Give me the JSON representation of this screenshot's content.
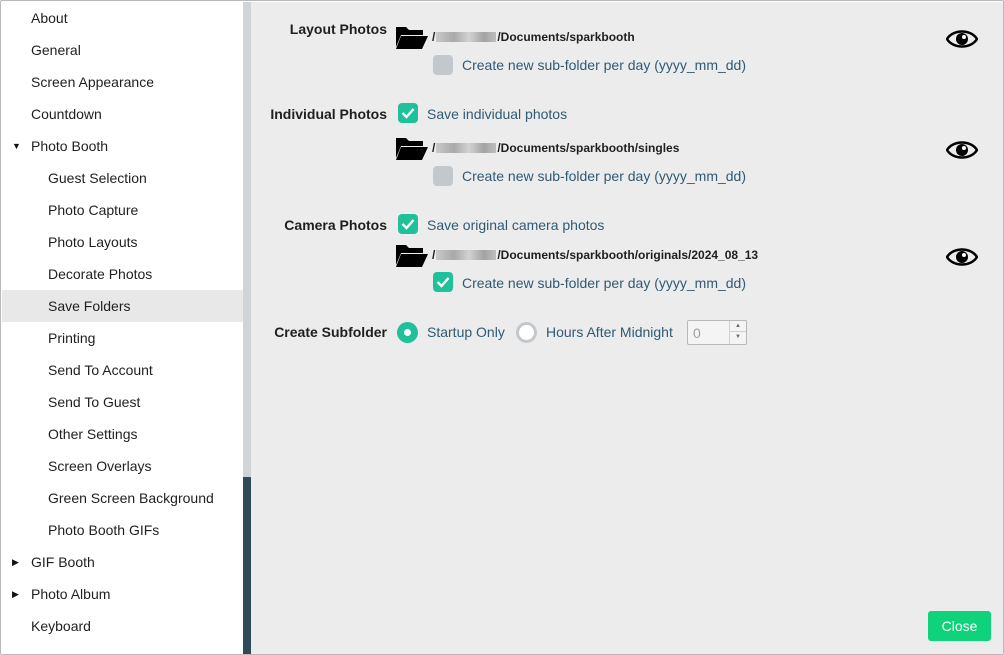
{
  "sidebar": {
    "items": [
      {
        "label": "About"
      },
      {
        "label": "General"
      },
      {
        "label": "Screen Appearance"
      },
      {
        "label": "Countdown"
      },
      {
        "label": "Photo Booth",
        "expanded": true
      },
      {
        "label": "Guest Selection"
      },
      {
        "label": "Photo Capture"
      },
      {
        "label": "Photo Layouts"
      },
      {
        "label": "Decorate Photos"
      },
      {
        "label": "Save Folders",
        "active": true
      },
      {
        "label": "Printing"
      },
      {
        "label": "Send To Account"
      },
      {
        "label": "Send To Guest"
      },
      {
        "label": "Other Settings"
      },
      {
        "label": "Screen Overlays"
      },
      {
        "label": "Green Screen Background"
      },
      {
        "label": "Photo Booth GIFs"
      },
      {
        "label": "GIF Booth",
        "expanded": false
      },
      {
        "label": "Photo Album",
        "expanded": false
      },
      {
        "label": "Keyboard"
      }
    ]
  },
  "icons": {
    "expanded": "caret-down-icon",
    "collapsed": "caret-right-icon",
    "folder": "folder-open-icon",
    "eye": "eye-icon"
  },
  "colors": {
    "accent": "#1ec19a",
    "close_button": "#0fd37a",
    "option_text": "#2f5a73",
    "scrollbar_thumb": "#2e4a58"
  },
  "layout_photos": {
    "label": "Layout Photos",
    "path_prefix": "/",
    "path_suffix": "/Documents/sparkbooth",
    "subfolder_checked": false,
    "subfolder_label": "Create new sub-folder per day (yyyy_mm_dd)"
  },
  "individual_photos": {
    "label": "Individual Photos",
    "save_checked": true,
    "save_label": "Save individual photos",
    "path_prefix": "/",
    "path_suffix": "/Documents/sparkbooth/singles",
    "subfolder_checked": false,
    "subfolder_label": "Create new sub-folder per day (yyyy_mm_dd)"
  },
  "camera_photos": {
    "label": "Camera Photos",
    "save_checked": true,
    "save_label": "Save original camera photos",
    "path_prefix": "/",
    "path_suffix": "/Documents/sparkbooth/originals/2024_08_13",
    "subfolder_checked": true,
    "subfolder_label": "Create new sub-folder per day (yyyy_mm_dd)"
  },
  "create_subfolder": {
    "label": "Create Subfolder",
    "options": [
      "Startup Only",
      "Hours After Midnight"
    ],
    "selected": "Startup Only",
    "hours_value": "0"
  },
  "close_label": "Close"
}
